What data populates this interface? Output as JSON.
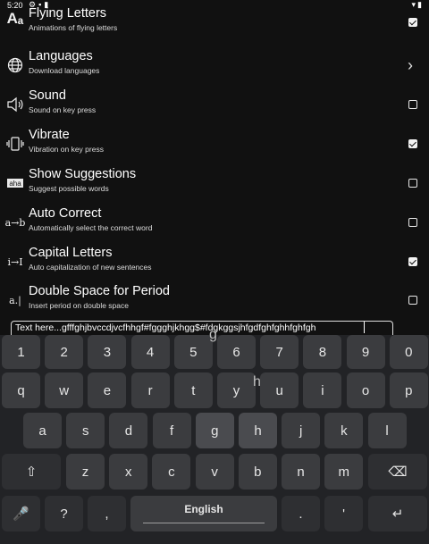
{
  "status_bar": {
    "time": "5:20",
    "left_icons": [
      "gear-icon",
      "notification-icon",
      "sd-card-icon"
    ],
    "right_icons": [
      "wifi-icon",
      "battery-icon"
    ]
  },
  "settings": [
    {
      "icon_text": "Aₐ",
      "icon": "flying-letters-icon",
      "title": "Flying Letters",
      "subtitle": "Animations of flying letters",
      "control": "checkbox",
      "checked": true
    },
    {
      "icon_text": "",
      "icon": "globe-icon",
      "title": "Languages",
      "subtitle": "Download languages",
      "control": "chevron",
      "chevron": "›"
    },
    {
      "icon_text": "",
      "icon": "speaker-icon",
      "title": "Sound",
      "subtitle": "Sound on key press",
      "control": "checkbox",
      "checked": false
    },
    {
      "icon_text": "",
      "icon": "vibrate-icon",
      "title": "Vibrate",
      "subtitle": "Vibration on key press",
      "control": "checkbox",
      "checked": true
    },
    {
      "icon_text": "aha",
      "icon": "suggestions-icon",
      "title": "Show Suggestions",
      "subtitle": "Suggest possible words",
      "control": "checkbox",
      "checked": false
    },
    {
      "icon_text": "a→b",
      "icon": "auto-correct-icon",
      "title": "Auto Correct",
      "subtitle": "Automatically select the correct word",
      "control": "checkbox",
      "checked": false
    },
    {
      "icon_text": "i→I",
      "icon": "capital-letters-icon",
      "title": "Capital Letters",
      "subtitle": "Auto capitalization of new sentences",
      "control": "checkbox",
      "checked": true
    },
    {
      "icon_text": "a.|",
      "icon": "double-space-icon",
      "title": "Double Space for Period",
      "subtitle": "Insert period on double space",
      "control": "checkbox",
      "checked": false
    }
  ],
  "text_field": {
    "value": "Text here...gfffghjbvccdjvcfhhgf#fggghjkhgg$#fdgkggsjhfgdfghfghhfghfgh"
  },
  "keyboard": {
    "rows": [
      [
        "1",
        "2",
        "3",
        "4",
        "5",
        "6",
        "7",
        "8",
        "9",
        "0"
      ],
      [
        "q",
        "w",
        "e",
        "r",
        "t",
        "y",
        "u",
        "i",
        "o",
        "p"
      ],
      [
        "a",
        "s",
        "d",
        "f",
        "g",
        "h",
        "j",
        "k",
        "l"
      ],
      [
        "z",
        "x",
        "c",
        "v",
        "b",
        "n",
        "m"
      ]
    ],
    "shift_symbol": "⇧",
    "backspace_symbol": "⌫",
    "mic_symbol": "🎤",
    "question_key": "?",
    "comma_key": ",",
    "space_label": "English",
    "period_key": ".",
    "apostrophe_key": "'",
    "enter_symbol": "↵",
    "pressed_keys": [
      "g",
      "h"
    ],
    "previews": [
      "g",
      "h"
    ]
  }
}
